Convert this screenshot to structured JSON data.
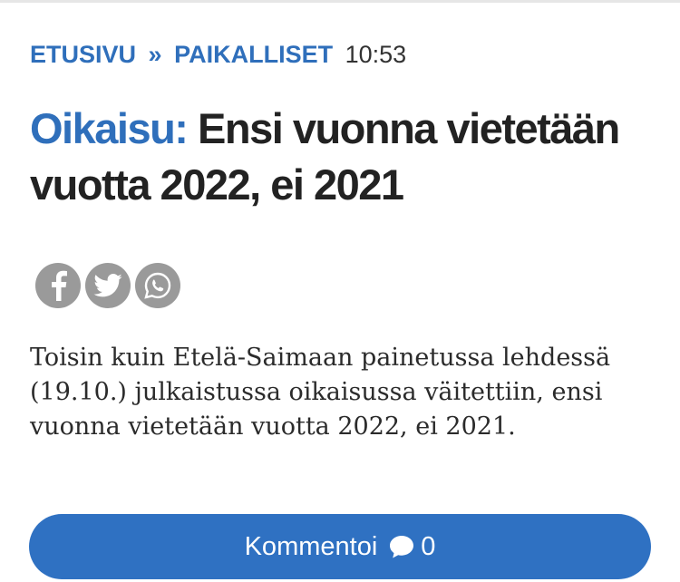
{
  "breadcrumb": {
    "home": "ETUSIVU",
    "separator": "»",
    "section": "PAIKALLISET",
    "time": "10:53"
  },
  "article": {
    "kicker": "Oikaisu:",
    "title": "Ensi vuonna viete­tään vuotta 2022, ei 2021",
    "body": "Toisin kuin Etelä-Saimaan painetussa lehdessä (19.10.) julkaistussa oikaisussa väitettiin, ensi vuonna vietetään vuotta 2022, ei 2021."
  },
  "share": {
    "icons": [
      "facebook-icon",
      "twitter-icon",
      "whatsapp-icon"
    ]
  },
  "comment_button": {
    "label": "Kommentoi",
    "count": "0"
  },
  "colors": {
    "accent": "#2f6fbb",
    "button": "#2f71c2",
    "share_icon_bg": "#9a9a9a",
    "text": "#222222"
  }
}
